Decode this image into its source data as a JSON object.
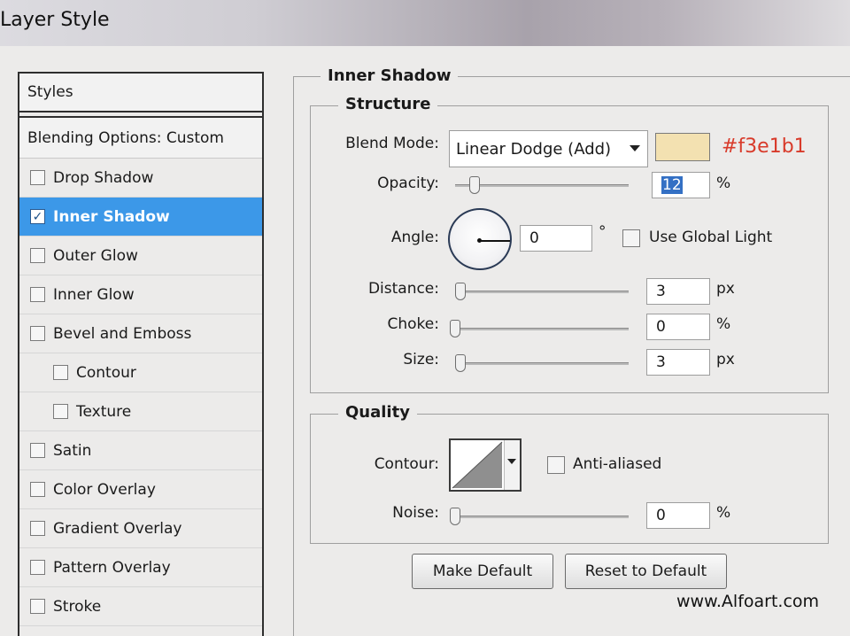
{
  "window": {
    "title": "Layer Style"
  },
  "sidebar": {
    "styles_label": "Styles",
    "blending_label": "Blending Options: Custom",
    "items": [
      {
        "label": "Drop Shadow",
        "checked": false
      },
      {
        "label": "Inner Shadow",
        "checked": true
      },
      {
        "label": "Outer Glow",
        "checked": false
      },
      {
        "label": "Inner Glow",
        "checked": false
      },
      {
        "label": "Bevel and Emboss",
        "checked": false
      },
      {
        "label": "Contour",
        "checked": false
      },
      {
        "label": "Texture",
        "checked": false
      },
      {
        "label": "Satin",
        "checked": false
      },
      {
        "label": "Color Overlay",
        "checked": false
      },
      {
        "label": "Gradient Overlay",
        "checked": false
      },
      {
        "label": "Pattern Overlay",
        "checked": false
      },
      {
        "label": "Stroke",
        "checked": false
      }
    ]
  },
  "panel": {
    "title": "Inner Shadow",
    "structure": {
      "title": "Structure",
      "blend_mode_label": "Blend Mode:",
      "blend_mode_value": "Linear Dodge (Add)",
      "color": "#f3e1b1",
      "color_annotation": "#f3e1b1",
      "opacity_label": "Opacity:",
      "opacity_value": "12",
      "opacity_unit": "%",
      "angle_label": "Angle:",
      "angle_value": "0",
      "angle_unit": "°",
      "global_light_label": "Use Global Light",
      "distance_label": "Distance:",
      "distance_value": "3",
      "distance_unit": "px",
      "choke_label": "Choke:",
      "choke_value": "0",
      "choke_unit": "%",
      "size_label": "Size:",
      "size_value": "3",
      "size_unit": "px"
    },
    "quality": {
      "title": "Quality",
      "contour_label": "Contour:",
      "anti_aliased_label": "Anti-aliased",
      "noise_label": "Noise:",
      "noise_value": "0",
      "noise_unit": "%"
    },
    "buttons": {
      "make_default": "Make Default",
      "reset_default": "Reset to Default"
    }
  },
  "watermark": "www.Alfoart.com"
}
